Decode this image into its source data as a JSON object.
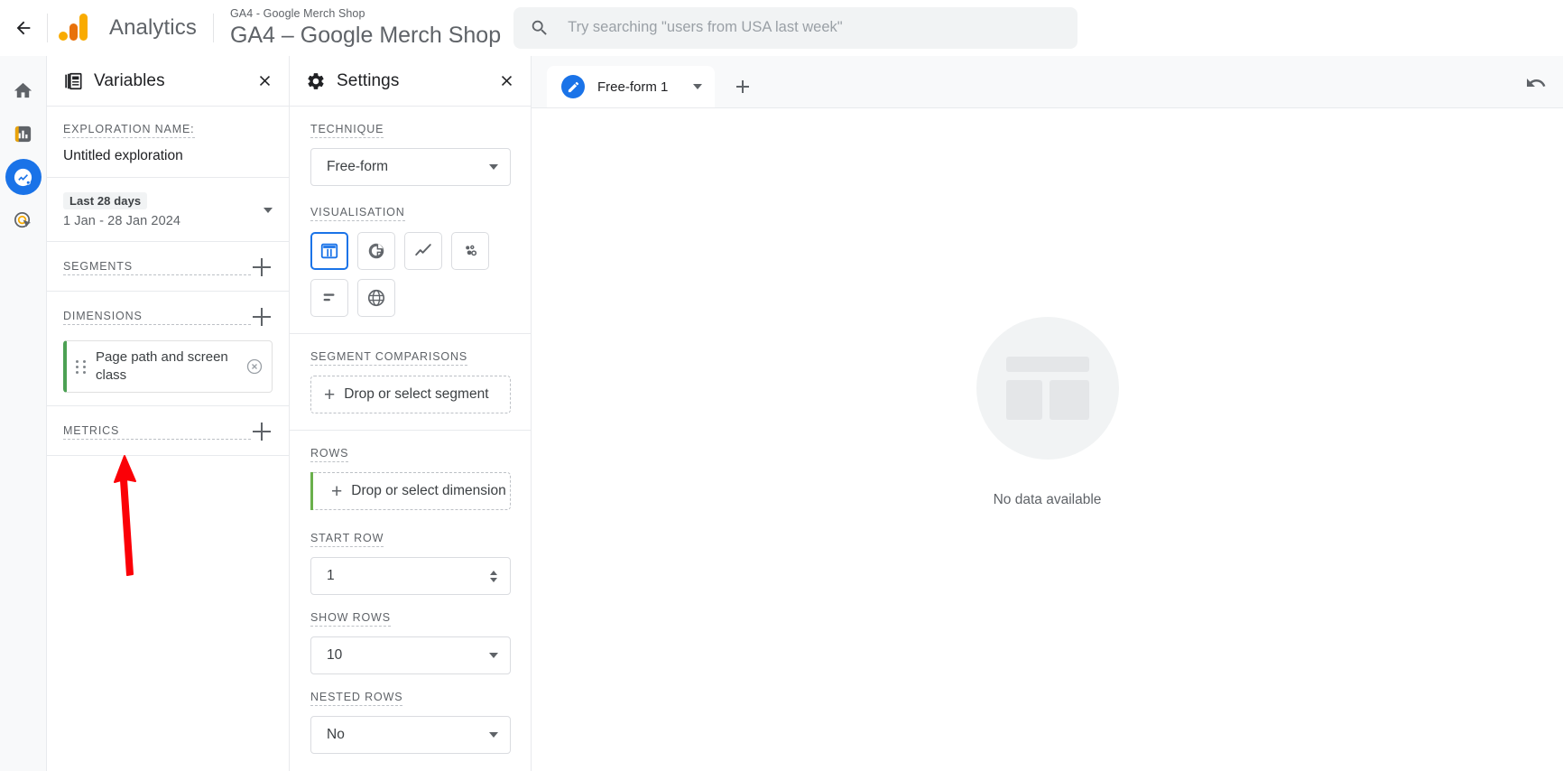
{
  "topbar": {
    "back_icon": "arrow-back-icon",
    "logo_icon": "google-analytics-logo",
    "brand": "Analytics",
    "property_sub": "GA4 - Google Merch Shop",
    "property_title": "GA4 – Google Merch Shop",
    "search_icon": "search-icon",
    "search_value": "",
    "search_placeholder": "Try searching \"users from USA last week\""
  },
  "rail": {
    "items": [
      {
        "name": "home-icon",
        "label": "Home",
        "active": false
      },
      {
        "name": "reports-icon",
        "label": "Reports",
        "active": false
      },
      {
        "name": "explore-icon",
        "label": "Explore",
        "active": true
      },
      {
        "name": "advertising-icon",
        "label": "Advertising",
        "active": false
      }
    ]
  },
  "variables": {
    "icon": "variables-icon",
    "title": "Variables",
    "close_icon": "close-icon",
    "exploration_name_label": "EXPLORATION NAME:",
    "exploration_name_value": "Untitled exploration",
    "date_chip": "Last 28 days",
    "date_range": "1 Jan - 28 Jan 2024",
    "segments_label": "SEGMENTS",
    "dimensions_label": "DIMENSIONS",
    "dimension_chips": [
      {
        "label": "Page path and screen class",
        "accent": "#4ca154"
      }
    ],
    "metrics_label": "METRICS",
    "add_icon": "plus-icon"
  },
  "settings": {
    "icon": "gear-icon",
    "title": "Settings",
    "close_icon": "close-icon",
    "technique_label": "TECHNIQUE",
    "technique_value": "Free-form",
    "visualisation_label": "VISUALISATION",
    "visualisations": [
      {
        "name": "table-chart-icon",
        "label": "Free-form table",
        "selected": true
      },
      {
        "name": "donut-chart-icon",
        "label": "Donut chart",
        "selected": false
      },
      {
        "name": "line-chart-icon",
        "label": "Line chart",
        "selected": false
      },
      {
        "name": "scatter-chart-icon",
        "label": "Scatter plot",
        "selected": false
      },
      {
        "name": "bar-chart-icon",
        "label": "Bar chart",
        "selected": false
      },
      {
        "name": "geo-map-icon",
        "label": "Geo map",
        "selected": false
      }
    ],
    "segment_comparisons_label": "SEGMENT COMPARISONS",
    "segment_dropzone": "Drop or select segment",
    "rows_label": "ROWS",
    "rows_dropzone": "Drop or select dimension",
    "start_row_label": "START ROW",
    "start_row_value": "1",
    "show_rows_label": "SHOW ROWS",
    "show_rows_value": "10",
    "nested_rows_label": "NESTED ROWS",
    "nested_rows_value": "No"
  },
  "canvas": {
    "tab_badge_icon": "edit-pencil-icon",
    "tab_label": "Free-form 1",
    "tab_caret_icon": "chevron-down-icon",
    "add_tab_icon": "plus-icon",
    "undo_icon": "undo-icon",
    "empty_text": "No data available"
  },
  "annotation": {
    "arrow_color": "#ff0000",
    "arrow_points_to": "METRICS"
  }
}
